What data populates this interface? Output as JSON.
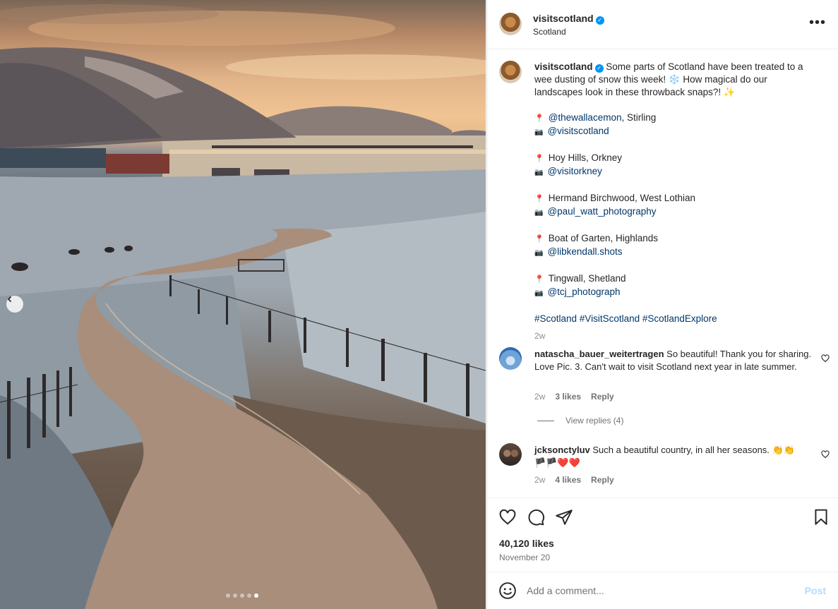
{
  "post": {
    "username": "visitscotland",
    "location": "Scotland",
    "more_icon": "more-horizontal-icon"
  },
  "caption": {
    "username": "visitscotland",
    "intro": "Some parts of Scotland have been treated to a wee dusting of snow this week! ❄️ How magical do our landscapes look in these throwback snaps?! ✨",
    "spots": [
      {
        "place": "@thewallacemon, Stirling",
        "place_mention": "@thewallacemon",
        "place_rest": ", Stirling",
        "credit": "@visitscotland"
      },
      {
        "place": "Hoy Hills, Orkney",
        "credit": "@visitorkney"
      },
      {
        "place": "Hermand Birchwood, West Lothian",
        "credit": "@paul_watt_photography"
      },
      {
        "place": "Boat of Garten, Highlands",
        "credit": "@libkendall.shots"
      },
      {
        "place": "Tingwall, Shetland",
        "credit": "@tcj_photograph"
      }
    ],
    "hashtags": "#Scotland #VisitScotland #ScotlandExplore",
    "time": "2w"
  },
  "comments": [
    {
      "username": "natascha_bauer_weitertragen",
      "text": "So beautiful! Thank you for sharing. Love Pic. 3. Can't wait to visit Scotland next year in late summer.",
      "time": "2w",
      "likes": "3 likes",
      "reply": "Reply"
    },
    {
      "username": "jcksonctyluv",
      "text": "Such a beautiful country, in all her seasons. 👏👏",
      "text2": "🏴🏴❤️❤️",
      "time": "2w",
      "likes": "4 likes",
      "reply": "Reply"
    }
  ],
  "view_replies": "View replies (4)",
  "footer": {
    "likes": "40,120 likes",
    "date": "November 20",
    "comment_placeholder": "Add a comment...",
    "post_label": "Post"
  },
  "carousel": {
    "slide_count": 5,
    "active_index": 4
  },
  "colors": {
    "link": "#00376b",
    "verified": "#0095f6",
    "post_button_disabled": "#b3dbff"
  }
}
